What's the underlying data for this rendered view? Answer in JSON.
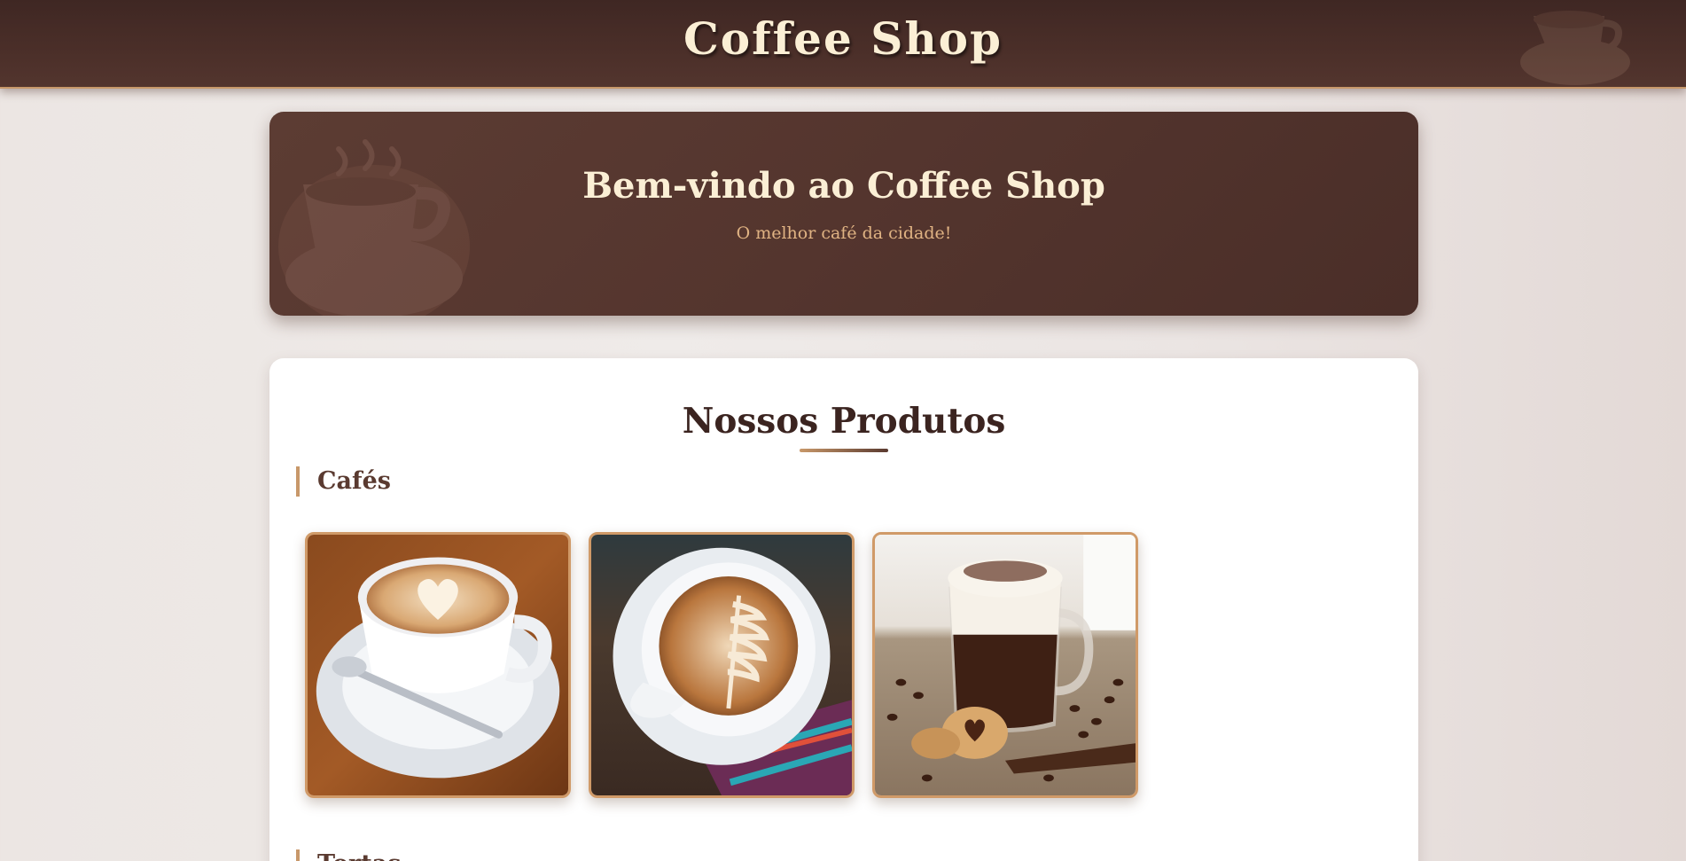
{
  "header": {
    "title": "Coffee Shop",
    "logo_icon": "coffee-cup-icon"
  },
  "hero": {
    "title": "Bem-vindo ao Coffee Shop",
    "subtitle": "O melhor café da cidade!",
    "decoration_icon": "coffee-cup-icon"
  },
  "products": {
    "title": "Nossos Produtos",
    "sections": [
      {
        "label": "Cafés",
        "items": [
          {
            "image": "cappuccino-heart-latte-art-photo"
          },
          {
            "image": "latte-rosetta-art-photo"
          },
          {
            "image": "glass-mocha-with-cookies-photo"
          }
        ]
      },
      {
        "label": "Tortas"
      }
    ]
  },
  "colors": {
    "header_bg": "#4a2e29",
    "accent": "#c8986a",
    "cream_text": "#fbefd5",
    "subtitle_text": "#e0b383",
    "dark_text": "#3b2420"
  }
}
